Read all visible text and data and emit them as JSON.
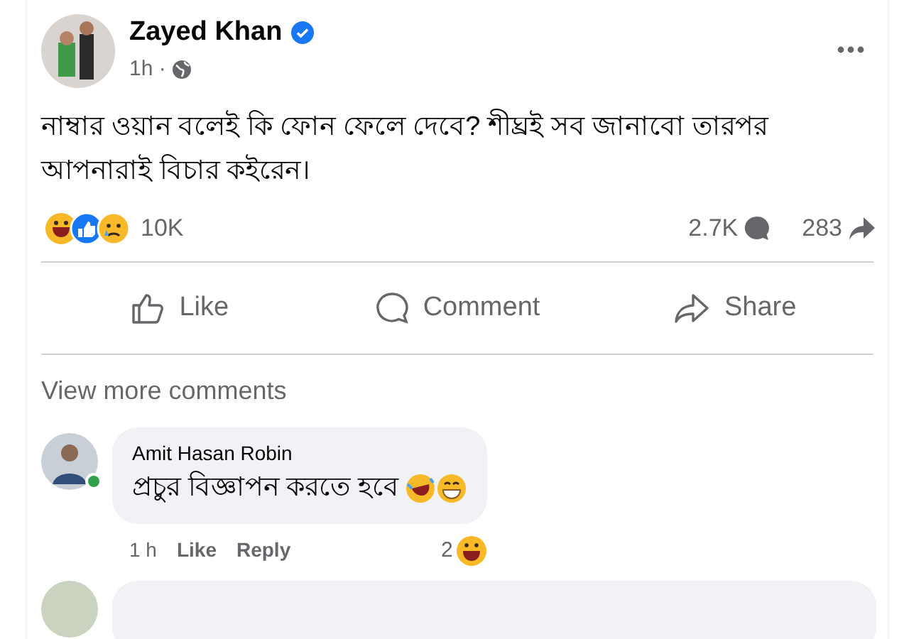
{
  "post": {
    "author": "Zayed Khan",
    "verified": true,
    "time": "1h ·",
    "text": "নাম্বার ওয়ান বলেই কি ফোন ফেলে দেবে? শীঘ্রই সব জানাবো তারপর আপনারাই বিচার কইরেন।",
    "reaction_count": "10K",
    "comment_count": "2.7K",
    "share_count": "283"
  },
  "actions": [
    {
      "kind": "like",
      "label": "Like"
    },
    {
      "kind": "comment",
      "label": "Comment"
    },
    {
      "kind": "share",
      "label": "Share"
    }
  ],
  "view_more": "View more comments",
  "comments": [
    {
      "author": "Amit Hasan Robin",
      "online": true,
      "text": "প্রচুর বিজ্ঞাপন করতে হবে",
      "time": "1 h",
      "like": "Like",
      "reply": "Reply",
      "reaction_count": "2"
    }
  ]
}
